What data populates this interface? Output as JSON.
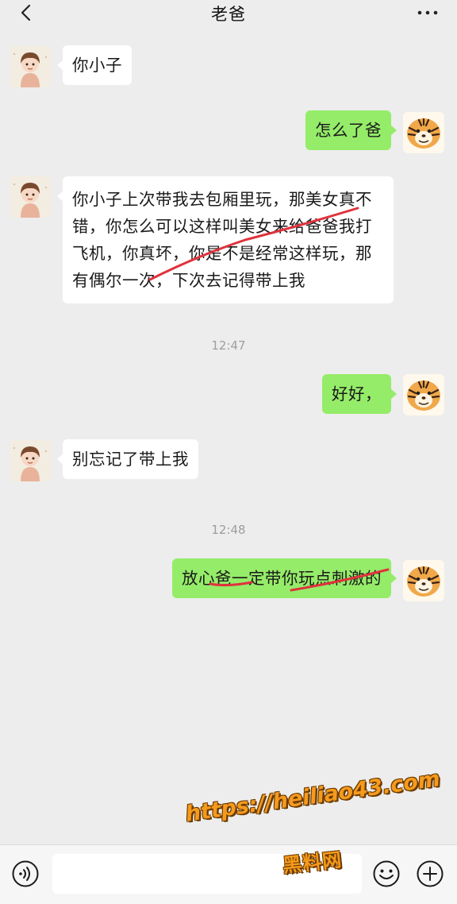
{
  "header": {
    "title": "老爸",
    "back_icon": "chevron-left-icon",
    "more_icon": "more-dots-icon"
  },
  "messages": [
    {
      "from": "contact",
      "text": "你小子"
    },
    {
      "from": "me",
      "text": "怎么了爸"
    },
    {
      "from": "contact",
      "lines": [
        "你小子上次带我去包厢里玩，那美女真不",
        "错，你怎么可以这样叫美女来给爸爸我打",
        "飞机，你真坏，你是不是经常这样玩，那",
        "有偶尔一次，下次去记得带上我"
      ]
    },
    {
      "from": "me",
      "text": "好好，"
    },
    {
      "from": "contact",
      "text": "别忘记了带上我"
    },
    {
      "from": "me",
      "text": "放心爸一定带你玩点刺激的"
    }
  ],
  "timestamps": [
    "12:47",
    "12:48"
  ],
  "input_bar": {
    "voice_icon": "voice-icon",
    "emoji_icon": "emoji-icon",
    "plus_icon": "plus-icon",
    "value": ""
  },
  "watermark": {
    "url": "https://heiliao43.com",
    "name": "黑料网"
  },
  "colors": {
    "background": "#ededed",
    "incoming_bubble": "#ffffff",
    "outgoing_bubble": "#95ec69",
    "strike_mark": "#e0323c",
    "watermark": "#f59a1c"
  }
}
